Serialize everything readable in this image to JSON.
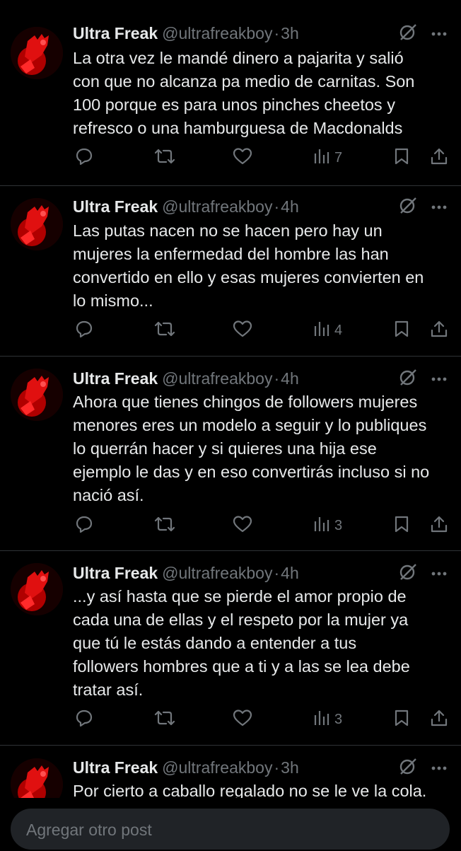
{
  "colors": {
    "background": "#000000",
    "text": "#e7e9ea",
    "muted": "#71767b",
    "divider": "#2f3336"
  },
  "posts": [
    {
      "author_name": "Ultra Freak",
      "handle": "@ultrafreakboy",
      "separator": "·",
      "time": "3h",
      "text": "La otra vez le mandé dinero a pajarita y salió\ncon que no alcanza pa medio de carnitas.  Son\n100 porque es para unos pinches cheetos y\nrefresco o una hamburguesa de Macdonalds",
      "views": "7",
      "icons": [
        "grok-icon",
        "more-icon",
        "reply-icon",
        "repost-icon",
        "like-icon",
        "views-icon",
        "bookmark-icon",
        "share-icon"
      ]
    },
    {
      "author_name": "Ultra Freak",
      "handle": "@ultrafreakboy",
      "separator": "·",
      "time": "4h",
      "text": "Las putas nacen no se hacen pero hay un\nmujeres la enfermedad del hombre las han\nconvertido en ello y esas mujeres convierten en\nlo mismo...",
      "views": "4"
    },
    {
      "author_name": "Ultra Freak",
      "handle": "@ultrafreakboy",
      "separator": "·",
      "time": "4h",
      "text": "Ahora que tienes chingos de followers mujeres\nmenores eres un modelo a seguir y lo publiques\nlo querrán hacer y si quieres una hija ese\nejemplo le das y en eso convertirás incluso si no\nnació así.",
      "views": "3"
    },
    {
      "author_name": "Ultra Freak",
      "handle": "@ultrafreakboy",
      "separator": "·",
      "time": "4h",
      "text": "...y así hasta que se pierde el amor propio de\ncada una de ellas y el respeto por la mujer ya\nque tú le estás dando a entender a tus\nfollowers hombres que a ti y a las se lea debe\ntratar así.",
      "views": "3"
    },
    {
      "author_name": "Ultra Freak",
      "handle": "@ultrafreakboy",
      "separator": "·",
      "time": "3h",
      "text": "Por cierto a caballo regalado no se le ve la cola."
    }
  ],
  "composer": {
    "placeholder": "Agregar otro post"
  }
}
